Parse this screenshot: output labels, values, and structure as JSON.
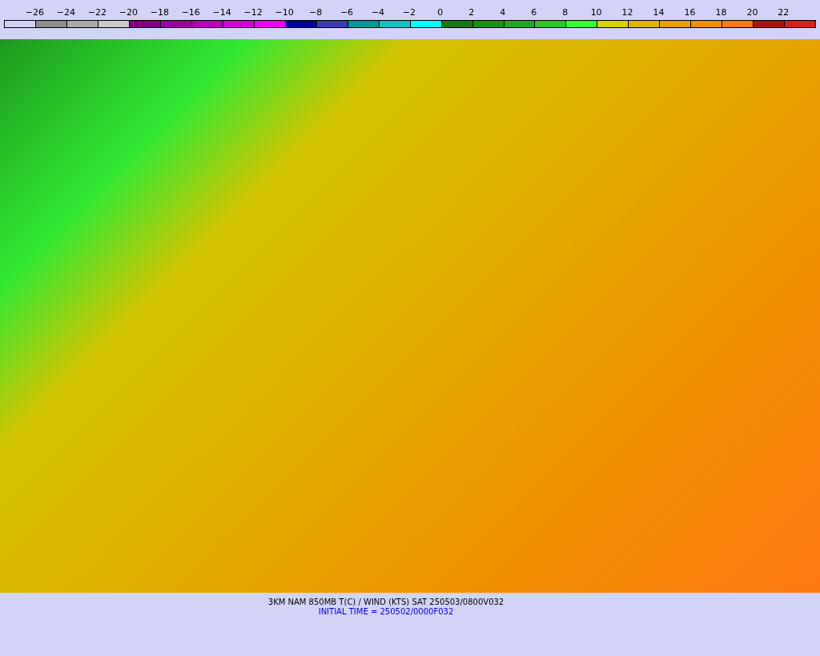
{
  "legend": {
    "labels": [
      "−26",
      "−24",
      "−22",
      "−20",
      "−18",
      "−16",
      "−14",
      "−12",
      "−10",
      "−8",
      "−6",
      "−4",
      "−2",
      "0",
      "2",
      "4",
      "6",
      "8",
      "10",
      "12",
      "14",
      "16",
      "18",
      "20",
      "22"
    ],
    "segments": [
      {
        "color": "#d0d0f8"
      },
      {
        "color": "#8c8c8c"
      },
      {
        "color": "#aaaaaa"
      },
      {
        "color": "#c8c8c8"
      },
      {
        "color": "#800080"
      },
      {
        "color": "#9c009c"
      },
      {
        "color": "#b800b8"
      },
      {
        "color": "#d400d4"
      },
      {
        "color": "#f000f0"
      },
      {
        "color": "#000098"
      },
      {
        "color": "#3c3cb0"
      },
      {
        "color": "#009898"
      },
      {
        "color": "#14c4c4"
      },
      {
        "color": "#00ffff"
      },
      {
        "color": "#147814"
      },
      {
        "color": "#149414"
      },
      {
        "color": "#1eaa1e"
      },
      {
        "color": "#28c828"
      },
      {
        "color": "#32ff32"
      },
      {
        "color": "#d4d400"
      },
      {
        "color": "#e0b400"
      },
      {
        "color": "#e8a000"
      },
      {
        "color": "#f09000"
      },
      {
        "color": "#ff7814"
      },
      {
        "color": "#a81414"
      },
      {
        "color": "#d42020"
      }
    ]
  },
  "caption": {
    "title": "3KM NAM 850MB T(C) / WIND (KTS) SAT 250503/0800V032",
    "initial_time": "INITIAL TIME = 250502/0000F032"
  }
}
